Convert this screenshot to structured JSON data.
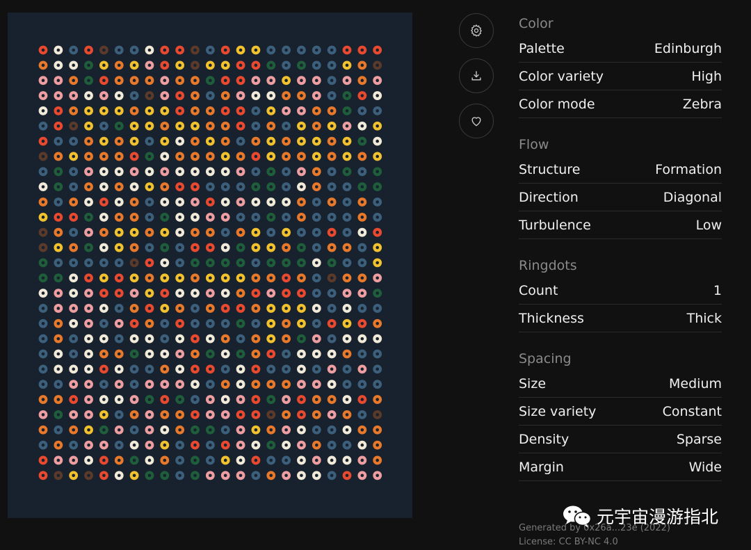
{
  "artwork": {
    "columns": 23,
    "rows": 30,
    "background": "#18222e",
    "palette": {
      "R": "#e8492f",
      "O": "#e8782a",
      "Y": "#f2c12e",
      "W": "#f1ead8",
      "P": "#ee9ea1",
      "G": "#1f5e3a",
      "B": "#3c5f7c",
      "D": "#5b3a2a"
    },
    "dot_rows": [
      "RWBRDBBWRRDBRYYBBBBBRRR",
      "OWWGYOYPRYDYYRRGBGBBYOD",
      "PPOGROOOPOOGRRPPYPPBPOP",
      "PPPWPWBDPROBOPWWOOPBGRW",
      "WROYYYOYYROORRBYPPOOGBB",
      "BRDYBGYYOYYOORBOBYOYPWY",
      "RBBOYOYBYWOYOBOYOYYOYGW",
      "DOYOOORGWOOOYORYOOYOYOY",
      "BGBPWWPWPWWWWPBGBPOBGBG",
      "WGBOWOWYORRBBBGGBWOBBGG",
      "OBOWRWOBWWPRWPWWWOBOBOB",
      "YRRGWOOBGWWPPBBGBOBBBOB",
      "DOBPOYYOYWOOBOYBYBBRBWR",
      "DYOGWYOBGBRRWGYYOGBOOBY",
      "GBBBBBDRWBGGGGBGGGWGBBY",
      "GGWRYRYOYYOYYYOOROBDOOP",
      "WPWPRRPYRWWPWORPRRBBPPG",
      "BPPPWBORYOBORROYYYWBWBB",
      "BOWPBPROBRBBBGBYOYBRYRO",
      "BOBWWBWWBWRWOBOYOGPBWWW",
      "BWBWOOGWWPOGWGORBWWWOBB",
      "BWWWRWBBOWRRBWRBBWBPBPB",
      "BBPPBPBPPPWBOWOOOPPWBBB",
      "OORPWWPGRGBPWPRGPROOWRO",
      "PGPPYBOPOORPPRRDOROPOBD",
      "OBOYGPBPWOGGBPYOPWBBWOO",
      "BOBPPBWPYBRBRPWGWPOBBWO",
      "RPPWROGWOBGBYWRBBWPWWPO",
      "RDYDRWYGGBGPPPBOPWWBRPP"
    ]
  },
  "toolbar": {
    "settings_icon": "gear-icon",
    "download_icon": "download-icon",
    "favorite_icon": "heart-icon"
  },
  "sections": {
    "color": {
      "title": "Color",
      "palette_label": "Palette",
      "palette_value": "Edinburgh",
      "variety_label": "Color variety",
      "variety_value": "High",
      "mode_label": "Color mode",
      "mode_value": "Zebra"
    },
    "flow": {
      "title": "Flow",
      "structure_label": "Structure",
      "structure_value": "Formation",
      "direction_label": "Direction",
      "direction_value": "Diagonal",
      "turbulence_label": "Turbulence",
      "turbulence_value": "Low"
    },
    "ringdots": {
      "title": "Ringdots",
      "count_label": "Count",
      "count_value": "1",
      "thickness_label": "Thickness",
      "thickness_value": "Thick"
    },
    "spacing": {
      "title": "Spacing",
      "size_label": "Size",
      "size_value": "Medium",
      "size_variety_label": "Size variety",
      "size_variety_value": "Constant",
      "density_label": "Density",
      "density_value": "Sparse",
      "margin_label": "Margin",
      "margin_value": "Wide"
    }
  },
  "footer": {
    "generated_by": "Generated by 0x26a...23e (2022)",
    "license": "License: CC BY-NC 4.0"
  },
  "watermark": {
    "text": "元宇宙漫游指北"
  }
}
